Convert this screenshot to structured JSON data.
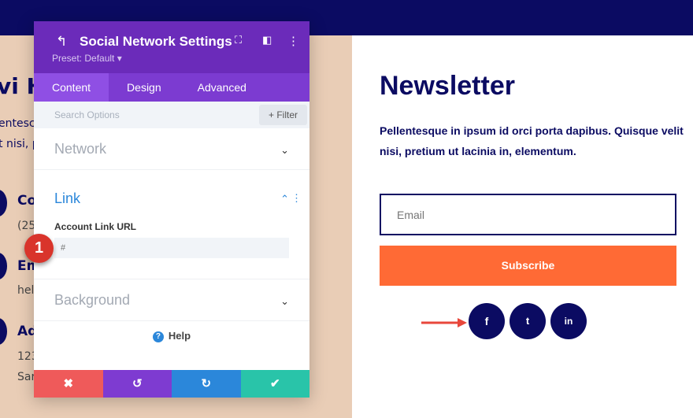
{
  "background_page": {
    "heading_fragment": "vi H",
    "text_fragments": [
      "entesc",
      "t nisi, p"
    ],
    "contact_items": [
      {
        "title": "Co",
        "value": "(25"
      },
      {
        "title": "Em",
        "value": "hel"
      },
      {
        "title": "Ad",
        "value": "123",
        "value2": "Sar"
      }
    ]
  },
  "panel": {
    "title": "Social Network Settings",
    "preset": "Preset: Default ▾",
    "tabs": [
      {
        "label": "Content",
        "active": true
      },
      {
        "label": "Design"
      },
      {
        "label": "Advanced"
      }
    ],
    "search_placeholder": "Search Options",
    "filter_label": "+ Filter",
    "sections": {
      "network": "Network",
      "link": "Link",
      "background": "Background"
    },
    "field_label": "Account Link URL",
    "field_placeholder": "#",
    "help_label": "Help",
    "footer_colors": {
      "cancel": "#ef5a5a",
      "undo": "#7e3bd1",
      "redo": "#2b87da",
      "save": "#29c4a9"
    }
  },
  "step_badge": "1",
  "newsletter": {
    "title": "Newsletter",
    "text": "Pellentesque in ipsum id orci porta dapibus. Quisque velit nisi, pretium ut lacinia in, elementum.",
    "email_placeholder": "Email",
    "subscribe_label": "Subscribe",
    "social": [
      {
        "icon": "facebook-icon",
        "glyph": "f"
      },
      {
        "icon": "twitter-icon",
        "glyph": "🐦"
      },
      {
        "icon": "linkedin-icon",
        "glyph": "in"
      }
    ]
  },
  "colors": {
    "navy": "#0b0b62",
    "purple": "#6b2bba",
    "orange": "#ff6a35",
    "peach": "#e9cdb6"
  }
}
